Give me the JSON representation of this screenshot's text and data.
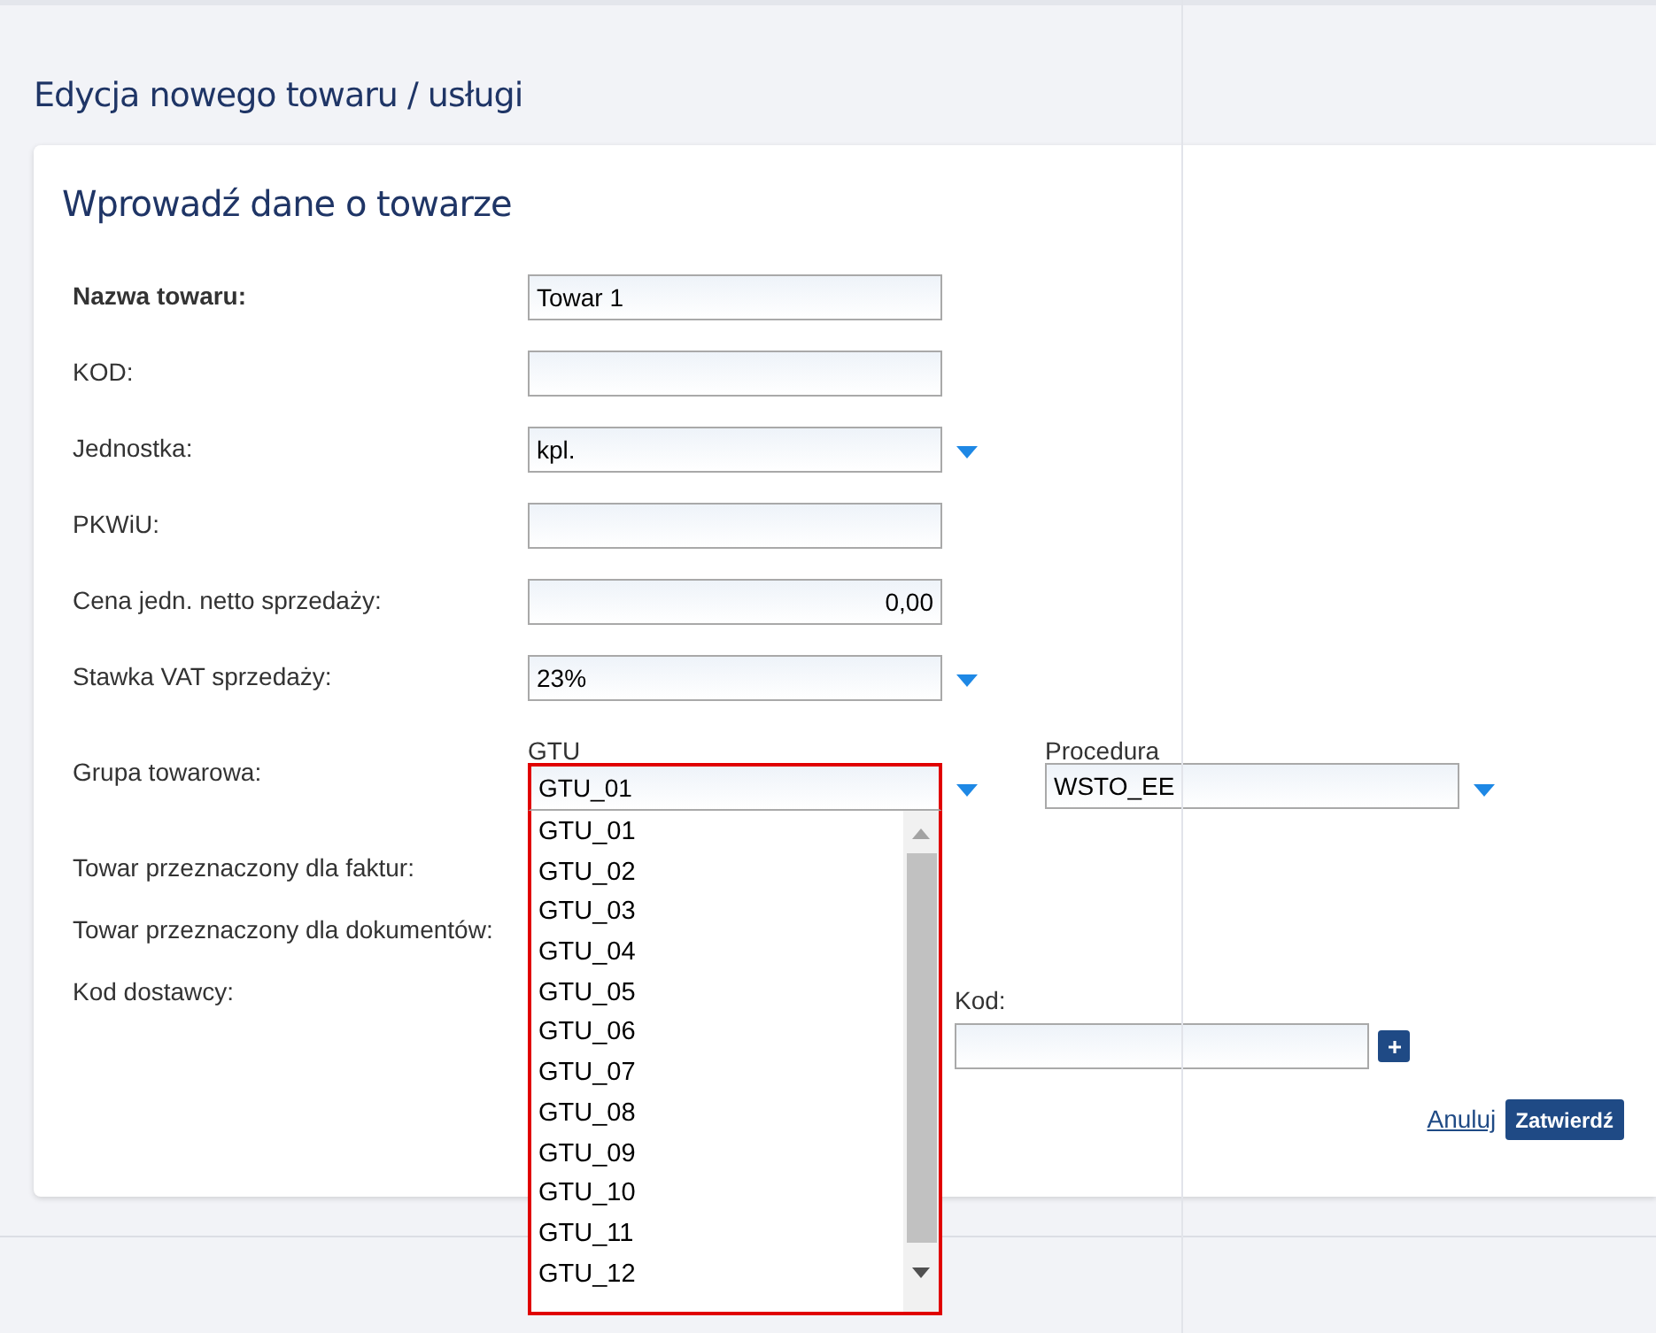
{
  "page": {
    "title": "Edycja nowego towaru / usługi"
  },
  "form": {
    "title": "Wprowadź dane o towarze",
    "fields": [
      {
        "label": "Nazwa towaru:",
        "emphasized": true,
        "kind": "text",
        "value": "Towar 1"
      },
      {
        "label": "KOD:",
        "emphasized": false,
        "kind": "text"
      },
      {
        "label": "Jednostka:",
        "emphasized": false,
        "kind": "select",
        "value": "kpl."
      },
      {
        "label": "PKWiU:",
        "emphasized": false,
        "kind": "text"
      },
      {
        "label": "Cena jedn. netto sprzedaży:",
        "emphasized": false,
        "kind": "number",
        "value": "0,00"
      },
      {
        "label": "Stawka VAT sprzedaży:",
        "emphasized": false,
        "kind": "select",
        "value": "23%"
      }
    ],
    "group": {
      "label": "Grupa towarowa:",
      "gtu": {
        "caption": "GTU",
        "value": "GTU_01",
        "expanded": true,
        "options": [
          "GTU_01",
          "GTU_02",
          "GTU_03",
          "GTU_04",
          "GTU_05",
          "GTU_06",
          "GTU_07",
          "GTU_08",
          "GTU_09",
          "GTU_10",
          "GTU_11",
          "GTU_12"
        ]
      },
      "procedure": {
        "caption": "Procedura",
        "value": "WSTO_EE",
        "expanded": false
      }
    },
    "invoice_label": "Towar przeznaczony dla faktur:",
    "documents_label": "Towar przeznaczony dla dokumentów:",
    "supplier": {
      "label": "Kod dostawcy:",
      "code_caption": "Kod:"
    },
    "cancel": "Anuluj",
    "confirm": "Zatwierdź"
  }
}
